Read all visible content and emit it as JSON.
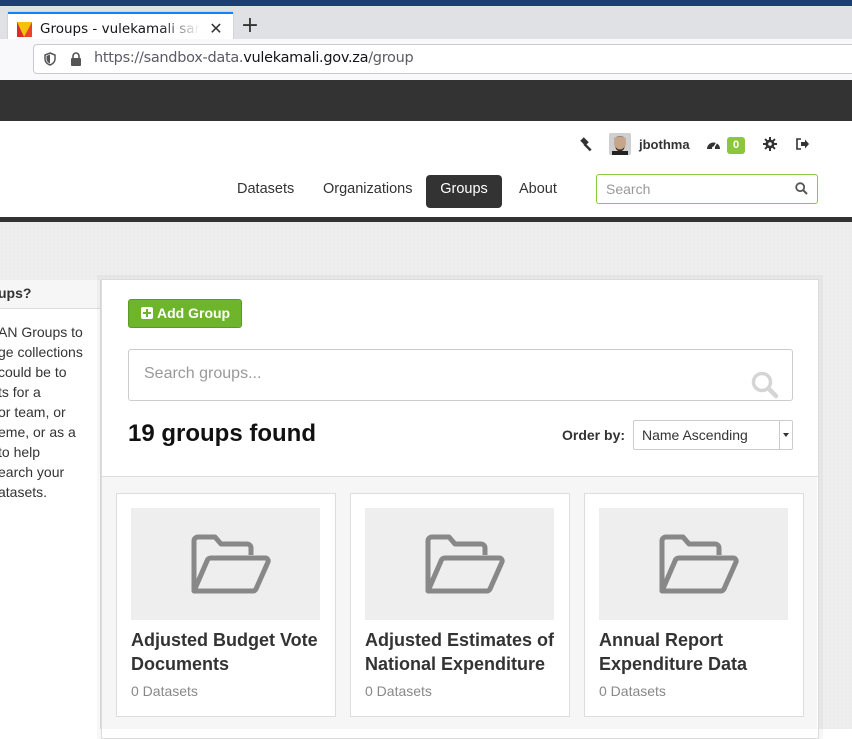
{
  "browser": {
    "tab_title": "Groups - vulekamali sandbox",
    "tab_close": "✕",
    "new_tab": "+",
    "url_prefix": "https://sandbox-data.",
    "url_host": "vulekamali.gov.za",
    "url_path": "/group"
  },
  "header": {
    "brand_fragment": "i",
    "username": "jbothma",
    "notifications_count": "0",
    "nav": {
      "datasets": "Datasets",
      "organizations": "Organizations",
      "groups": "Groups",
      "about": "About"
    },
    "search_placeholder": "Search"
  },
  "sidebar": {
    "title": "ups?",
    "lines": [
      "AN Groups to",
      "ge collections",
      "could be to",
      "ts for a",
      "or team, or",
      "eme, or as a",
      "to help",
      "earch your",
      "atasets."
    ]
  },
  "main": {
    "add_button_label": "Add Group",
    "search_placeholder": "Search groups...",
    "results_count": "19 groups found",
    "order_by_label": "Order by:",
    "order_by_value": "Name Ascending",
    "groups": [
      {
        "title": "Adjusted Budget Vote Documents",
        "count": "0 Datasets"
      },
      {
        "title": "Adjusted Estimates of National Expenditure",
        "count": "0 Datasets"
      },
      {
        "title": "Annual Report Expenditure Data",
        "count": "0 Datasets"
      }
    ]
  },
  "colors": {
    "accent_green": "#6fb52c",
    "dark_bar": "#333333",
    "badge_green": "#8cc63f"
  }
}
